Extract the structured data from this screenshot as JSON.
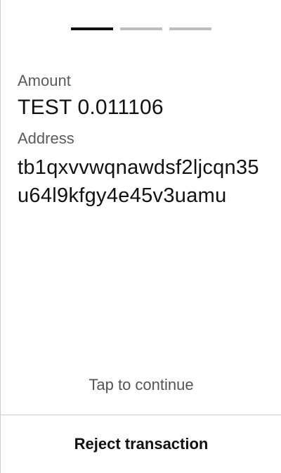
{
  "progress": {
    "total_steps": 3,
    "current_step": 1
  },
  "fields": {
    "amount_label": "Amount",
    "amount_value": "TEST 0.011106",
    "address_label": "Address",
    "address_value": "tb1qxvvwqnawdsf2ljcqn35u64l9kfgy4e45v3uamu"
  },
  "actions": {
    "continue_label": "Tap to continue",
    "reject_label": "Reject transaction"
  },
  "colors": {
    "active_step": "#111111",
    "inactive_step": "#bdbdbd",
    "label_text": "#5b5b5b",
    "value_text": "#111111",
    "divider": "#cfcfcf"
  }
}
